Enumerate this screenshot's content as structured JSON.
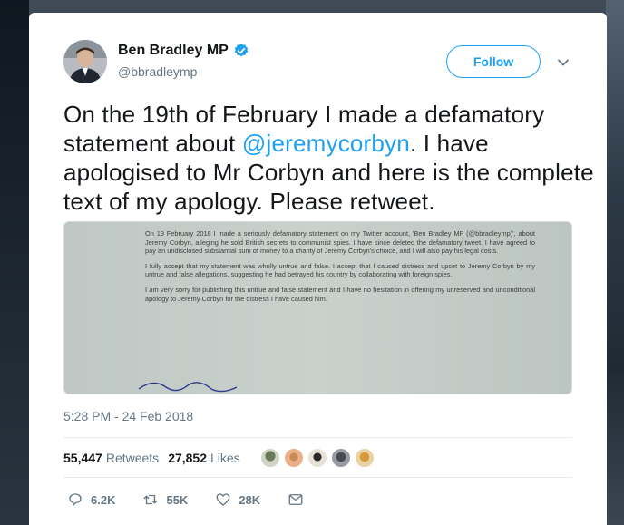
{
  "tweet": {
    "author_name": "Ben Bradley MP",
    "author_handle": "@bbradleymp",
    "follow_label": "Follow",
    "text_before": "On the 19th of February I made a defamatory statement about ",
    "mention": "@jeremycorbyn",
    "text_after": ". I have apologised to Mr Corbyn and here is the complete text of my apology. Please retweet.",
    "timestamp": "5:28 PM - 24 Feb 2018",
    "retweets_count": "55,447",
    "retweets_label": "Retweets",
    "likes_count": "27,852",
    "likes_label": "Likes",
    "reply_count": "6.2K",
    "retweet_action_count": "55K",
    "like_action_count": "28K"
  },
  "letter": {
    "paragraph_1": "On 19 February 2018 I made a seriously defamatory statement on my Twitter account, 'Ben Bradley MP (@bbradleymp)', about Jeremy Corbyn, alleging he sold British secrets to communist spies. I have since deleted the defamatory tweet. I have agreed to pay an undisclosed substantial sum of money to a charity of Jeremy Corbyn's choice, and I will also pay his legal costs.",
    "paragraph_2": "I fully accept that my statement was wholly untrue and false. I accept that I caused distress and upset to Jeremy Corbyn by my untrue and false allegations, suggesting he had betrayed his country by collaborating with foreign spies.",
    "paragraph_3": "I am very sorry for publishing this untrue and false statement and I have no hesitation in offering my unreserved and unconditional apology to Jeremy Corbyn for the distress I have caused him."
  },
  "icons": {
    "verified": "verified-badge-icon",
    "caret": "chevron-down-icon",
    "reply": "reply-icon",
    "retweet": "retweet-icon",
    "like": "heart-icon",
    "message": "envelope-icon"
  },
  "colors": {
    "accent": "#1da1f2",
    "text": "#14171a",
    "muted": "#657786"
  }
}
